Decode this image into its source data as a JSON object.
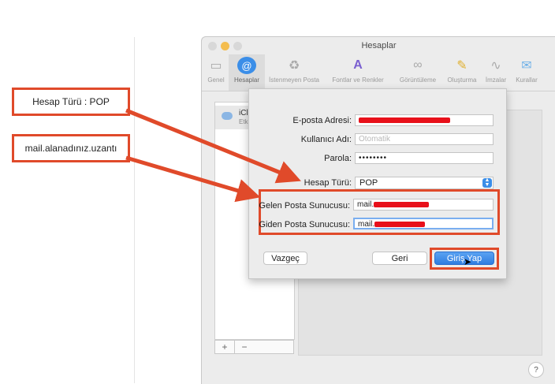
{
  "callouts": {
    "account_type": "Hesap Türü : POP",
    "server": "mail.alanadınız.uzantı"
  },
  "window": {
    "title": "Hesaplar"
  },
  "toolbar": {
    "items": [
      {
        "label": "Genel",
        "icon": "switch-icon"
      },
      {
        "label": "Hesaplar",
        "icon": "at-icon"
      },
      {
        "label": "İstenmeyen Posta",
        "icon": "trash-icon"
      },
      {
        "label": "Fontlar ve Renkler",
        "icon": "font-icon"
      },
      {
        "label": "Görüntüleme",
        "icon": "glasses-icon"
      },
      {
        "label": "Oluşturma",
        "icon": "pencil-icon"
      },
      {
        "label": "İmzalar",
        "icon": "signature-icon"
      },
      {
        "label": "Kurallar",
        "icon": "rules-icon"
      }
    ]
  },
  "accounts": {
    "name": "iCl",
    "sub": "Etk"
  },
  "list_buttons": {
    "add": "+",
    "remove": "−"
  },
  "help": "?",
  "form": {
    "email_label": "E-posta Adresi:",
    "username_label": "Kullanıcı Adı:",
    "username_placeholder": "Otomatik",
    "password_label": "Parola:",
    "password_value": "••••••••",
    "account_type_label": "Hesap Türü:",
    "account_type_value": "POP",
    "incoming_label": "Gelen Posta Sunucusu:",
    "incoming_value": "mail.",
    "outgoing_label": "Giden Posta Sunucusu:",
    "outgoing_value": "mail."
  },
  "buttons": {
    "cancel": "Vazgeç",
    "back": "Geri",
    "login": "Giriş Yap"
  },
  "colors": {
    "accent": "#3b8ee8",
    "annotation": "#e04a2a",
    "redaction": "#e8101a"
  }
}
